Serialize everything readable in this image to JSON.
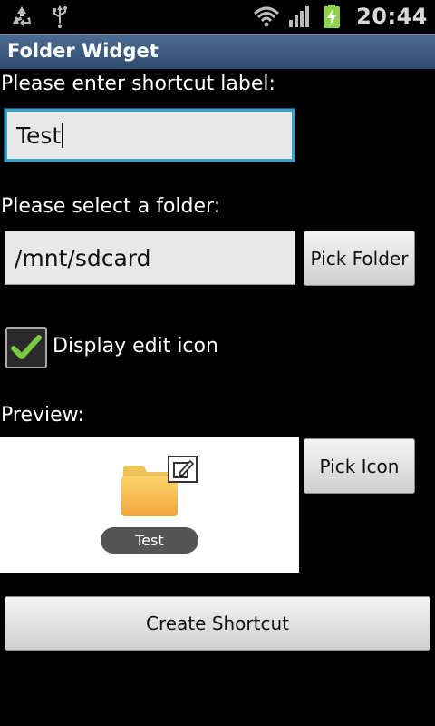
{
  "status_bar": {
    "time": "20:44",
    "left_icons": [
      "recycle-icon",
      "usb-icon"
    ],
    "right_icons": [
      "wifi-icon",
      "signal-icon",
      "battery-charging-icon"
    ]
  },
  "app": {
    "title": "Folder Widget"
  },
  "form": {
    "shortcut_label_prompt": "Please enter shortcut label:",
    "shortcut_label_value": "Test",
    "folder_prompt": "Please select a folder:",
    "folder_value": "/mnt/sdcard",
    "pick_folder_label": "Pick Folder",
    "display_edit_icon_label": "Display edit icon",
    "display_edit_icon_checked": true,
    "preview_label": "Preview:",
    "preview_name": "Test",
    "pick_icon_label": "Pick Icon",
    "create_shortcut_label": "Create Shortcut"
  },
  "colors": {
    "title_bar": "#3b5a80",
    "focus_border": "#3aa0c8",
    "check_green": "#7ac943",
    "folder_yellow": "#f7c64f"
  }
}
